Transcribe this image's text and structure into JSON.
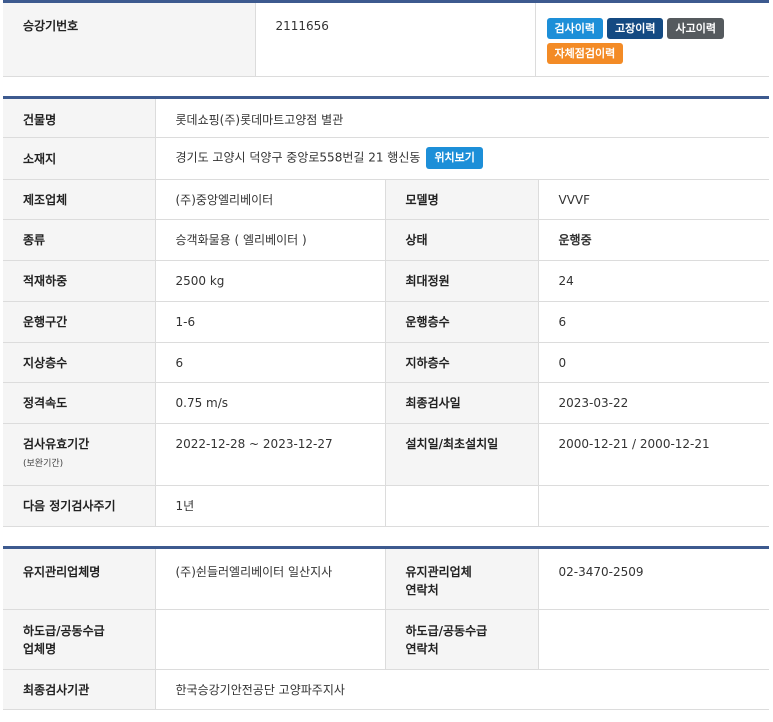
{
  "top": {
    "label": "승강기번호",
    "value": "2111656",
    "buttons": {
      "inspection_history": "검사이력",
      "failure_history": "고장이력",
      "accident_history": "사고이력",
      "self_check_history": "자체점검이력"
    },
    "colors": {
      "inspection": "#1d8fd8",
      "failure": "#144a82",
      "accident": "#555a5e",
      "self_check": "#f38b26"
    }
  },
  "building": {
    "name_label": "건물명",
    "name_value": "롯데쇼핑(주)롯데마트고양점 별관",
    "address_label": "소재지",
    "address_value": "경기도 고양시 덕양구 중앙로558번길 21 행신동",
    "location_button": "위치보기",
    "rows": [
      {
        "l1": "제조업체",
        "v1": "(주)중앙엘리베이터",
        "l2": "모델명",
        "v2": "VVVF"
      },
      {
        "l1": "종류",
        "v1": "승객화물용 ( 엘리베이터 )",
        "l2": "상태",
        "v2": "운행중"
      },
      {
        "l1": "적재하중",
        "v1": "2500 kg",
        "l2": "최대정원",
        "v2": "24"
      },
      {
        "l1": "운행구간",
        "v1": "1-6",
        "l2": "운행층수",
        "v2": "6"
      },
      {
        "l1": "지상층수",
        "v1": "6",
        "l2": "지하층수",
        "v2": "0"
      },
      {
        "l1": "정격속도",
        "v1": "0.75 m/s",
        "l2": "최종검사일",
        "v2": "2023-03-22"
      }
    ],
    "validity_label": "검사유효기간",
    "validity_sublabel": "(보완기간)",
    "validity_value": "2022-12-28 ~ 2023-12-27",
    "install_label": "설치일/최초설치일",
    "install_value": "2000-12-21 / 2000-12-21",
    "cycle_label": "다음 정기검사주기",
    "cycle_value": "1년"
  },
  "maintenance": {
    "company_label": "유지관리업체명",
    "company_value": "(주)쉰들러엘리베이터 일산지사",
    "contact_label_1": "유지관리업체",
    "contact_label_2": "연락처",
    "contact_value": "02-3470-2509",
    "sub_label_1": "하도급/공동수급",
    "sub_label_2": "업체명",
    "sub_value": "",
    "sub_contact_label_1": "하도급/공동수급",
    "sub_contact_label_2": "연락처",
    "sub_contact_value": "",
    "agency_label": "최종검사기관",
    "agency_value": "한국승강기안전공단 고양파주지사"
  }
}
